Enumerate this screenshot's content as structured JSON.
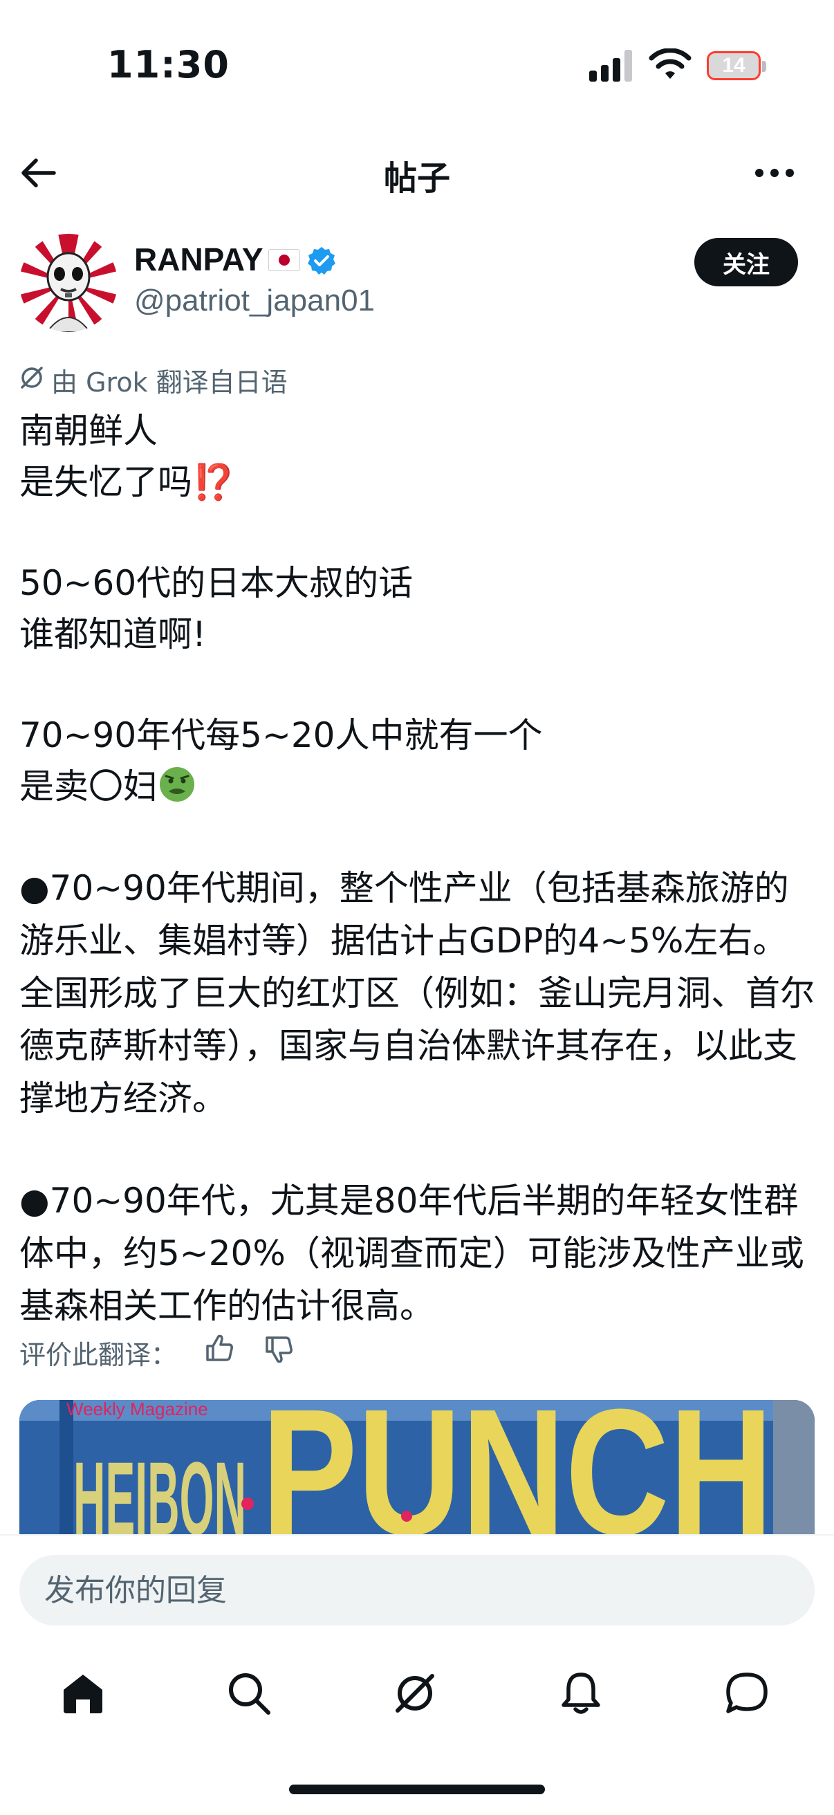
{
  "status_bar": {
    "time": "11:30",
    "battery": "14"
  },
  "nav": {
    "title": "帖子"
  },
  "author": {
    "name": "RANPAY",
    "handle": "@patriot_japan01",
    "follow_label": "关注"
  },
  "translation_note": "由 Grok 翻译自日语",
  "post": {
    "line1": "南朝鲜人",
    "line2": "是失忆了吗",
    "line2_emoji": "⁉️",
    "line3": "50~60代的日本大叔的话",
    "line4": "谁都知道啊!",
    "line5": "70~90年代每5~20人中就有一个",
    "line6": "是卖〇妇",
    "para1": "●70~90年代期间，整个性产业（包括基森旅游的游乐业、集娼村等）据估计占GDP的4~5%左右。全国形成了巨大的红灯区（例如：釜山完月洞、首尔德克萨斯村等），国家与自治体默许其存在，以此支撑地方经济。",
    "para2": "●70~90年代，尤其是80年代后半期的年轻女性群体中，约5~20%（视调查而定）可能涉及性产业或基森相关工作的估计很高。"
  },
  "rate": {
    "label": "评价此翻译："
  },
  "media": {
    "caption": "Weekly Magazine",
    "title_a": "HEIBON",
    "title_b": "PUNCH"
  },
  "reply": {
    "placeholder": "发布你的回复"
  },
  "icons": [
    "back-arrow-icon",
    "more-icon",
    "verified-badge-icon",
    "japan-flag-icon",
    "grok-icon",
    "thumbs-up-icon",
    "thumbs-down-icon",
    "home-icon",
    "search-icon",
    "grok-tab-icon",
    "notifications-icon",
    "messages-icon"
  ],
  "colors": {
    "accent": "#1d9bf0",
    "text": "#0f1419",
    "muted": "#536471",
    "follow_bg": "#0f1419"
  }
}
